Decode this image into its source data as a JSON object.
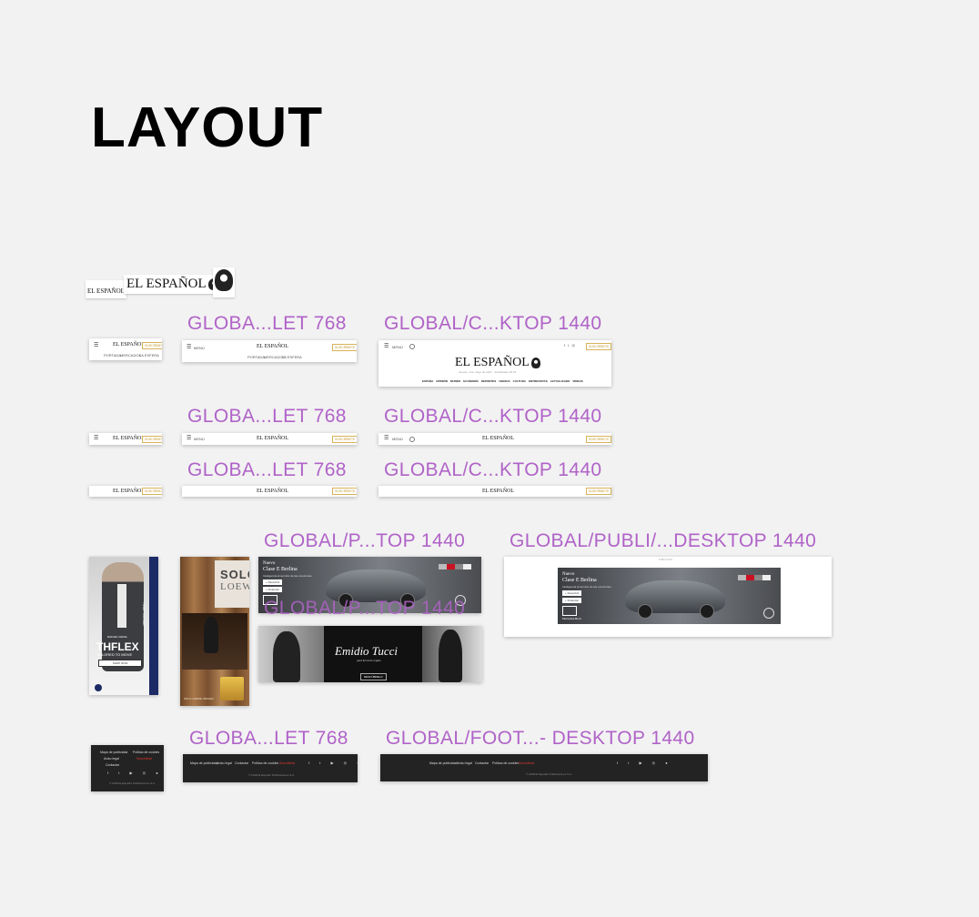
{
  "page_title": "LAYOUT",
  "logo_text": "EL ESPAÑOL",
  "header": {
    "subscribe": "SUSCRÍBETE",
    "menu": "MENÚ",
    "tabs": [
      "PORTADA",
      "MERCADOS",
      "LA ESFERA"
    ],
    "date_line": "Jueves, 4 de mayo de 2017 · Actualizado 18:44",
    "desktop_nav": [
      "ESPAÑA",
      "OPINIÓN",
      "MUNDO",
      "ECONOMÍA",
      "DEPORTES",
      "CIENCIA",
      "CULTURA",
      "ENTREVISTAS",
      "ACTUALIZADO",
      "VÍDEOS"
    ]
  },
  "labels": {
    "tablet_768": "GLOBA...LET 768",
    "desktop_1440": "GLOBAL/C...KTOP 1440",
    "publi_p_1440": "GLOBAL/P...TOP 1440",
    "publi_desktop_1440": "GLOBAL/PUBLI/...DESKTOP 1440",
    "footer_desktop_1440": "GLOBAL/FOOT...- DESKTOP 1440"
  },
  "ads": {
    "tommy_brand": "TOMMY HILFIGER",
    "tommy_sub": "RAFAEL NADAL",
    "tommy_headline": "THFLEX",
    "tommy_tagline": "TAILORED TO MOVE",
    "tommy_cta": "SHOP NOW",
    "loewe_title": "SOLO",
    "loewe_brand": "LOEWE",
    "loewe_caption": "SOLO LOEWE ORIGEN",
    "merc_kicker": "Nuevo",
    "merc_model": "Clase E Berlina",
    "merc_tagline": "Inteligencia al servicio de las emociones.",
    "merc_btn1": "+ Descubrir",
    "merc_btn2": "+ Financiar",
    "merc_brand": "Mercedes-Benz",
    "puig_brand": "Emidio Tucci",
    "puig_store": "para El Corte Inglés",
    "puig_cta": "DESCÚBRELO",
    "publicidad": "PUBLICIDAD"
  },
  "footer": {
    "links": [
      "Mapa de publicidad",
      "Aviso legal",
      "Contactar",
      "Política de cookies"
    ],
    "highlight": "Suscribirse",
    "social": [
      "f",
      "t",
      "y",
      "i",
      "p"
    ],
    "copyright": "© 2018 El Español Publicaciones S.A."
  },
  "colors": {
    "label_purple": "#b063c8",
    "subscribe_gold": "#c49a2c",
    "footer_bg": "#232323",
    "footer_red": "#e2372a",
    "tommy_navy": "#1c2a66"
  }
}
